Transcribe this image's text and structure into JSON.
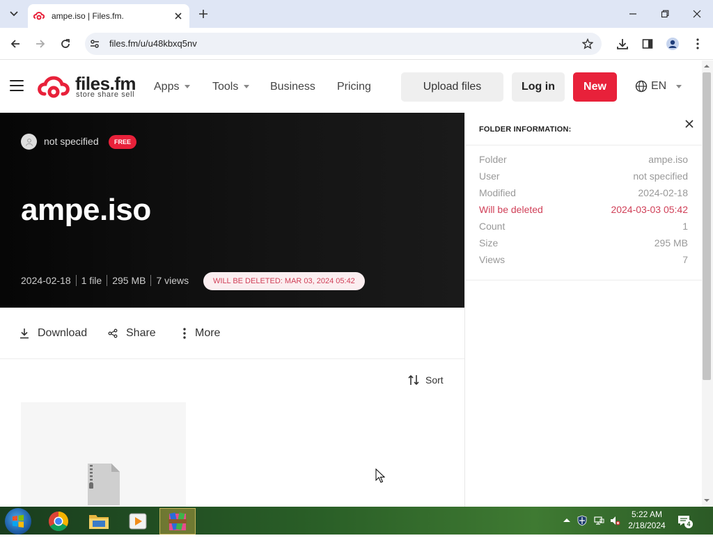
{
  "browser": {
    "tab_title": "ampe.iso | Files.fm.",
    "url": "files.fm/u/u48kbxq5nv"
  },
  "header": {
    "logo_name": "files.fm",
    "logo_tagline": "store share sell",
    "nav": {
      "apps": "Apps",
      "tools": "Tools",
      "business": "Business",
      "pricing": "Pricing"
    },
    "upload_label": "Upload files",
    "login_label": "Log in",
    "new_label": "New",
    "language": "EN"
  },
  "hero": {
    "owner": "not specified",
    "badge": "FREE",
    "title": "ampe.iso",
    "meta": {
      "date": "2024-02-18",
      "files": "1 file",
      "size": "295 MB",
      "views": "7 views"
    },
    "deletion_notice": "WILL BE DELETED: MAR 03, 2024 05:42"
  },
  "actions": {
    "download": "Download",
    "share": "Share",
    "more": "More",
    "sort": "Sort"
  },
  "folder_info": {
    "heading": "FOLDER INFORMATION:",
    "rows": [
      {
        "label": "Folder",
        "value": "ampe.iso"
      },
      {
        "label": "User",
        "value": "not specified"
      },
      {
        "label": "Modified",
        "value": "2024-02-18"
      },
      {
        "label": "Will be deleted",
        "value": "2024-03-03 05:42"
      },
      {
        "label": "Count",
        "value": "1"
      },
      {
        "label": "Size",
        "value": "295 MB"
      },
      {
        "label": "Views",
        "value": "7"
      }
    ]
  },
  "taskbar": {
    "time": "5:22 AM",
    "date": "2/18/2024",
    "notification_count": "4"
  },
  "colors": {
    "brand_red": "#e8213a",
    "warning_text": "#d04058",
    "hero_bg": "#0b0b0b"
  },
  "icons": [
    "tab-search-icon",
    "filesfm-favicon",
    "close-icon",
    "plus-icon",
    "minimize-icon",
    "maximize-icon",
    "back-icon",
    "forward-icon",
    "reload-icon",
    "site-settings-icon",
    "star-icon",
    "download-icon",
    "side-panel-icon",
    "profile-icon",
    "kebab-menu-icon",
    "hamburger-icon",
    "globe-icon",
    "share-icon",
    "sort-icon",
    "zip-file-icon",
    "user-avatar-icon"
  ]
}
